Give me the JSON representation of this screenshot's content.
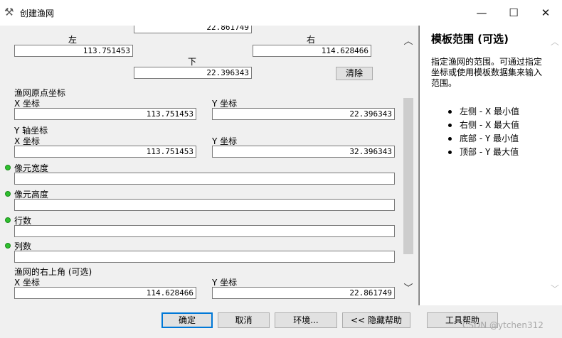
{
  "window": {
    "title": "创建渔网"
  },
  "form": {
    "top_partial_value": "22.861749",
    "left_label": "左",
    "left_value": "113.751453",
    "right_label": "右",
    "right_value": "114.628466",
    "bottom_label": "下",
    "bottom_value": "22.396343",
    "clear_button": "清除",
    "origin_heading": "渔网原点坐标",
    "origin_x_label": "X 坐标",
    "origin_x_value": "113.751453",
    "origin_y_label": "Y 坐标",
    "origin_y_value": "22.396343",
    "yaxis_heading": "Y 轴坐标",
    "yaxis_x_label": "X 坐标",
    "yaxis_x_value": "113.751453",
    "yaxis_y_label": "Y 坐标",
    "yaxis_y_value": "32.396343",
    "cell_width_label": "像元宽度",
    "cell_width_value": "",
    "cell_height_label": "像元高度",
    "cell_height_value": "",
    "rows_label": "行数",
    "rows_value": "",
    "cols_label": "列数",
    "cols_value": "",
    "corner_heading": "渔网的右上角 (可选)",
    "corner_x_label": "X 坐标",
    "corner_x_value": "114.628466",
    "corner_y_label": "Y 坐标",
    "corner_y_value": "22.861749"
  },
  "help": {
    "title": "模板范围 (可选)",
    "body": "指定渔网的范围。可通过指定坐标或使用模板数据集来输入范围。",
    "items": [
      "左侧 - X 最小值",
      "右侧 - X 最大值",
      "底部 - Y 最小值",
      "顶部 - Y 最大值"
    ]
  },
  "buttons": {
    "ok": "确定",
    "cancel": "取消",
    "env": "环境...",
    "hide_help": "<< 隐藏帮助",
    "tool_help": "工具帮助"
  },
  "watermark": "CSDN @ytchen312",
  "icons": {
    "title": "hammer-icon",
    "minimize": "minimize-icon",
    "maximize": "maximize-icon",
    "close": "close-icon",
    "scroll_up": "chevron-up-icon",
    "scroll_down": "chevron-down-icon",
    "required": "green-dot-icon"
  },
  "colors": {
    "required_dot": "#2fc02f",
    "primary_border": "#0078d7"
  }
}
